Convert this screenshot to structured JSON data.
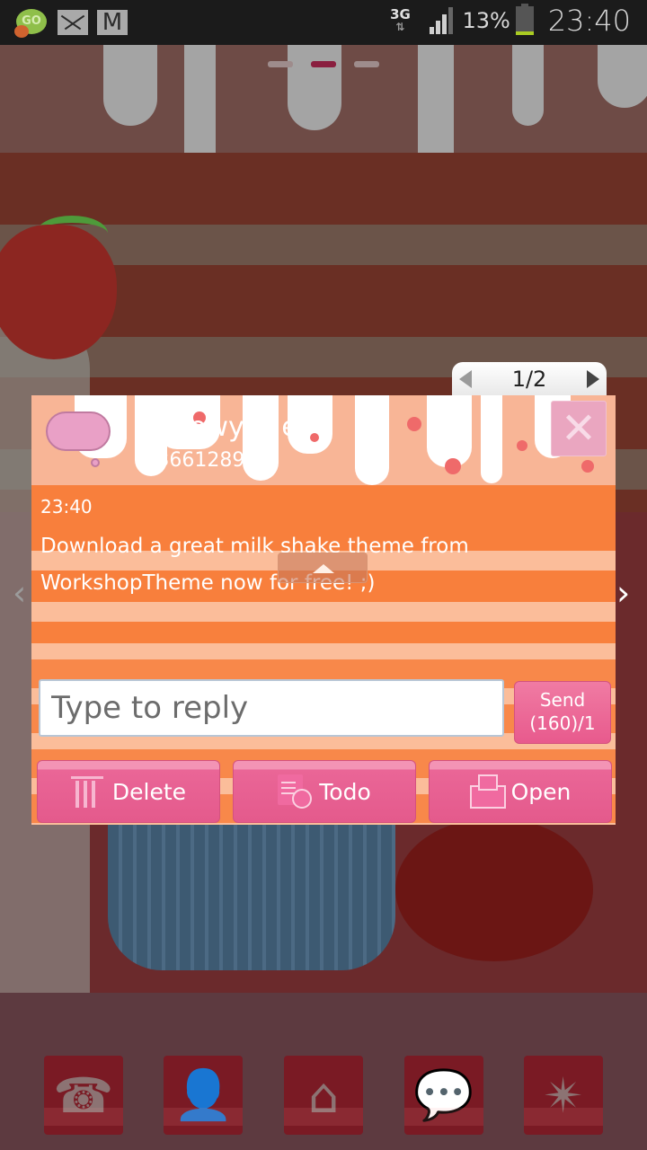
{
  "status_bar": {
    "left_icons": [
      "go-sms-icon",
      "email-icon",
      "gmail-icon"
    ],
    "network": "3G",
    "battery_percent": "13%",
    "battery_level": 0.13,
    "time": "23:40"
  },
  "home": {
    "page_indicator": {
      "count": 3,
      "active": 2
    },
    "dock": [
      {
        "name": "phone",
        "icon": "phone-icon",
        "glyph": "☎"
      },
      {
        "name": "contacts",
        "icon": "contacts-icon",
        "glyph": "👤"
      },
      {
        "name": "home",
        "icon": "home-icon",
        "glyph": "⌂"
      },
      {
        "name": "messages",
        "icon": "messages-icon",
        "glyph": "💬"
      },
      {
        "name": "app-drawer",
        "icon": "star-icon",
        "glyph": "✴"
      }
    ]
  },
  "popup": {
    "pager": "1/2",
    "contact_name": "Moj owy N e",
    "contact_number": "+ 3661289 9",
    "message_time": "23:40",
    "message_text": "Download a great milk shake theme from WorkshopTheme now for free! ;)",
    "reply_placeholder": "Type to reply",
    "reply_value": "",
    "send_label": "Send",
    "send_counter": "(160)/1",
    "actions": {
      "delete": "Delete",
      "todo": "Todo",
      "open": "Open"
    }
  },
  "colors": {
    "accent_pink": "#e85a8d",
    "message_orange": "#f87f3c",
    "header_peach": "#f8b596"
  }
}
